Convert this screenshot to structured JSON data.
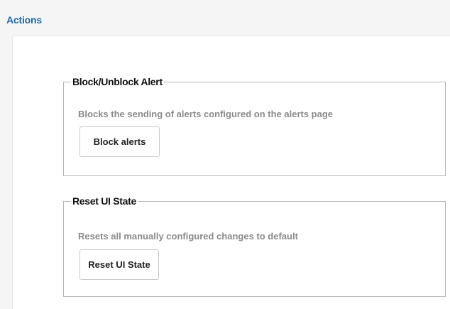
{
  "page": {
    "title": "Actions"
  },
  "sections": [
    {
      "legend": "Block/Unblock Alert",
      "description": "Blocks the sending of alerts configured on the alerts page",
      "button_label": "Block alerts"
    },
    {
      "legend": "Reset UI State",
      "description": "Resets all manually configured changes to default",
      "button_label": "Reset UI State"
    }
  ],
  "colors": {
    "title": "#1e6aa8",
    "background": "#f5f5f5",
    "panel": "#ffffff",
    "fieldset_border": "#b5b5b5",
    "description": "#8a8a8a"
  }
}
